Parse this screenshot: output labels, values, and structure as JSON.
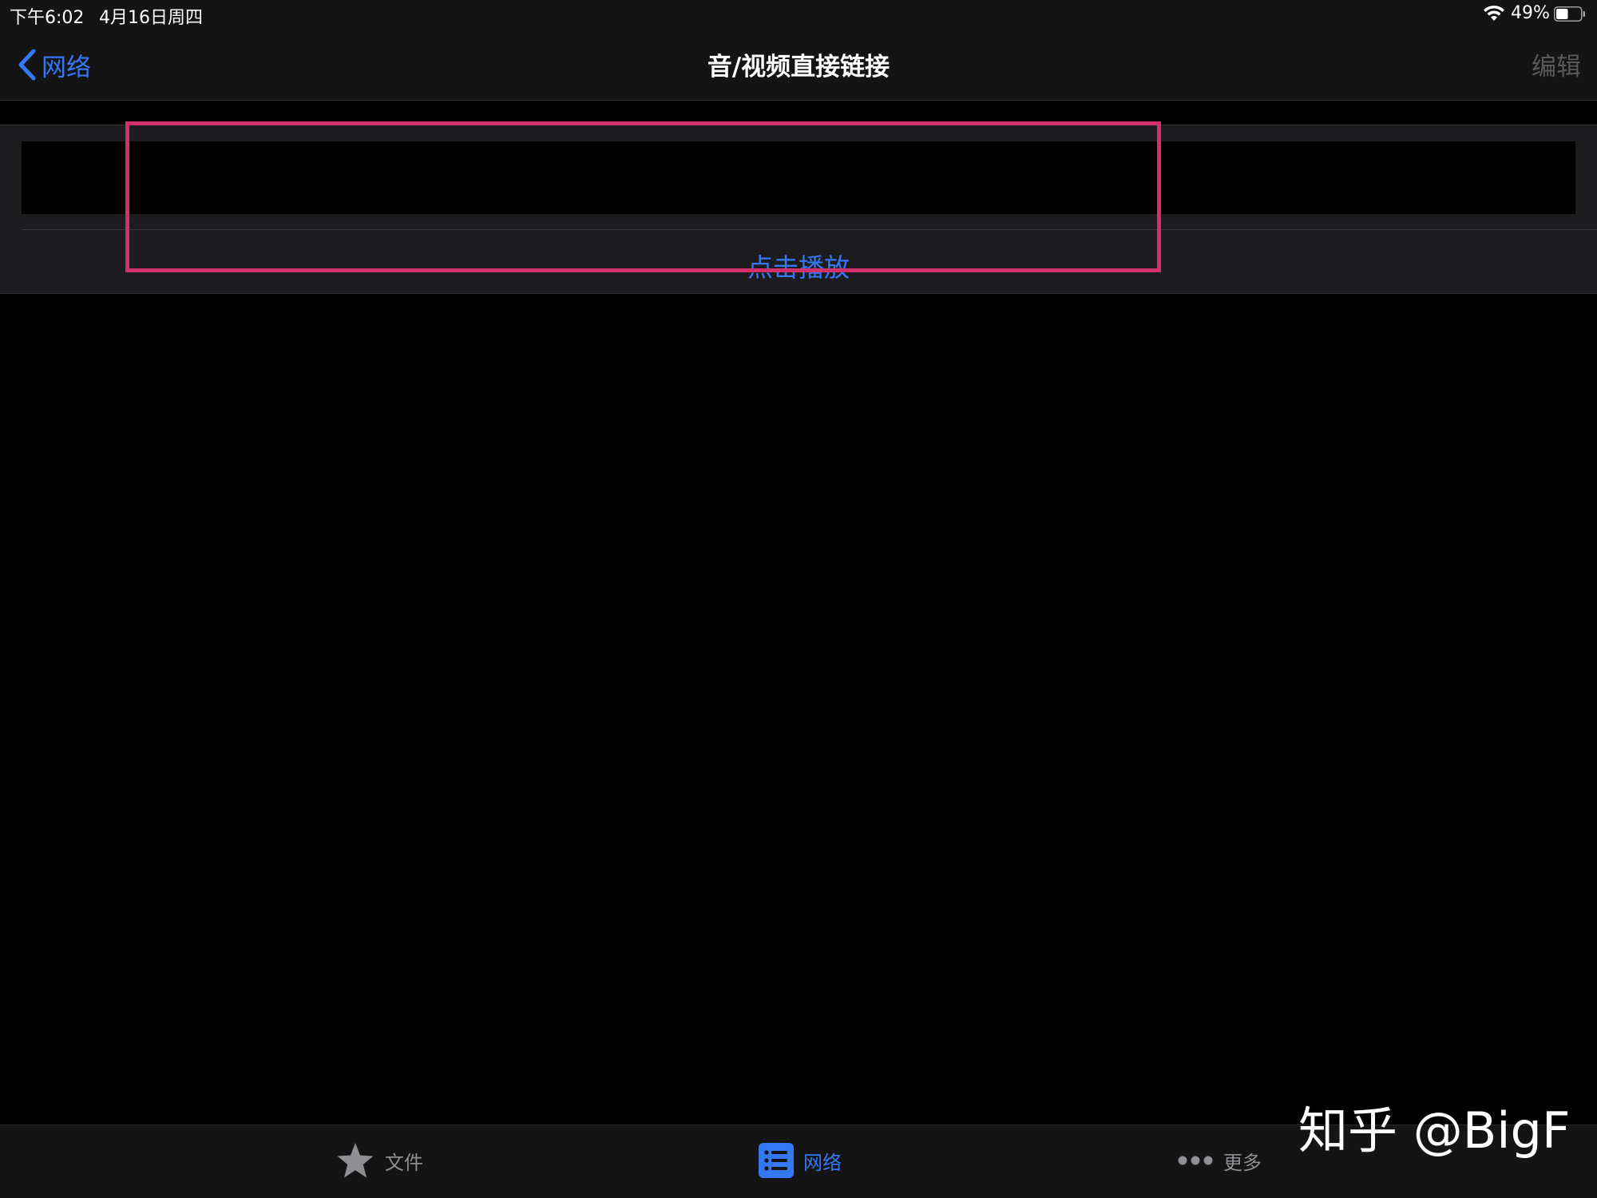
{
  "status_bar": {
    "time": "下午6:02",
    "date": "4月16日周四",
    "battery": "49%",
    "battery_level": 0.49,
    "wifi_icon": "wifi-icon",
    "battery_icon": "battery-icon"
  },
  "nav": {
    "back_label": "网络",
    "title": "音/视频直接链接",
    "edit_label": "编辑",
    "back_icon": "chevron-left-icon"
  },
  "form": {
    "url_value": "",
    "play_label": "点击播放"
  },
  "tabbar": {
    "tabs": [
      {
        "label": "文件",
        "icon": "star-icon",
        "active": false
      },
      {
        "label": "网络",
        "icon": "list-icon",
        "active": true
      },
      {
        "label": "更多",
        "icon": "ellipsis-icon",
        "active": false
      }
    ]
  },
  "watermark": "知乎 @BigF",
  "colors": {
    "accent": "#3478f6",
    "highlight": "#d1306b",
    "inactive": "#8e8e93"
  }
}
